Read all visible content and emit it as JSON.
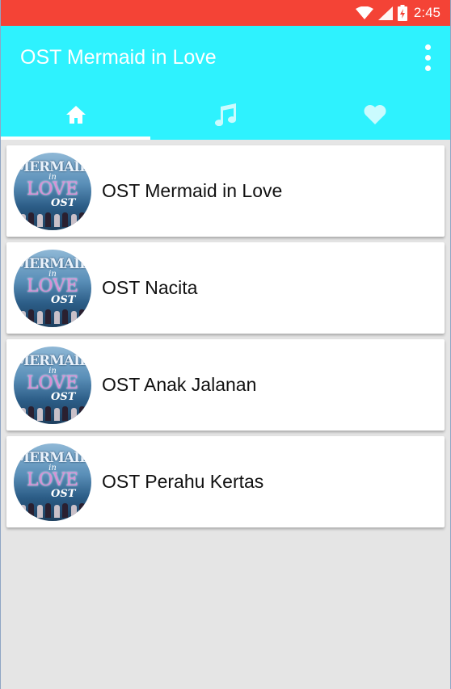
{
  "status_bar": {
    "time": "2:45",
    "background": "#f44336",
    "icons": [
      "wifi-icon",
      "signal-icon",
      "battery-charging-icon"
    ]
  },
  "app_bar": {
    "title": "OST Mermaid in Love",
    "background": "#2ef2fe",
    "menu_icon": "more-vert-icon"
  },
  "tabs": [
    {
      "icon": "home-icon",
      "selected": true
    },
    {
      "icon": "music-note-icon",
      "selected": false
    },
    {
      "icon": "heart-icon",
      "selected": false
    }
  ],
  "thumbnail": {
    "line1": "MERMAID",
    "line2": "in",
    "line3": "LOVE",
    "line4": "OST"
  },
  "playlist": [
    {
      "label": "OST Mermaid in Love"
    },
    {
      "label": "OST Nacita"
    },
    {
      "label": "OST Anak Jalanan"
    },
    {
      "label": "OST Perahu Kertas"
    }
  ]
}
